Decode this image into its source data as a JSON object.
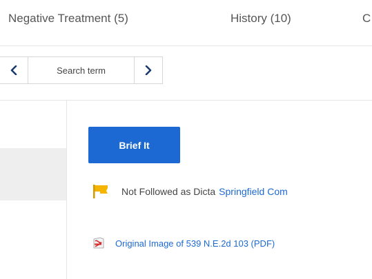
{
  "tabs": [
    {
      "label": "Negative Treatment (5)"
    },
    {
      "label": "History (10)"
    },
    {
      "label": "C"
    }
  ],
  "search_nav": {
    "prev_icon": "chevron-left-icon",
    "label": "Search term",
    "next_icon": "chevron-right-icon"
  },
  "actions": {
    "brief_label": "Brief It"
  },
  "treatment": {
    "icon": "yellow-flag-icon",
    "flag_color": "#f5b400",
    "label": "Not Followed as Dicta",
    "link_text": "Springfield Com"
  },
  "pdf": {
    "icon": "pdf-icon",
    "link_text": "Original Image of 539 N.E.2d 103 (PDF)"
  },
  "colors": {
    "accent": "#1c69d3",
    "link": "#1c69d3",
    "border": "#d6d6d6",
    "panel": "#eeeeee"
  }
}
